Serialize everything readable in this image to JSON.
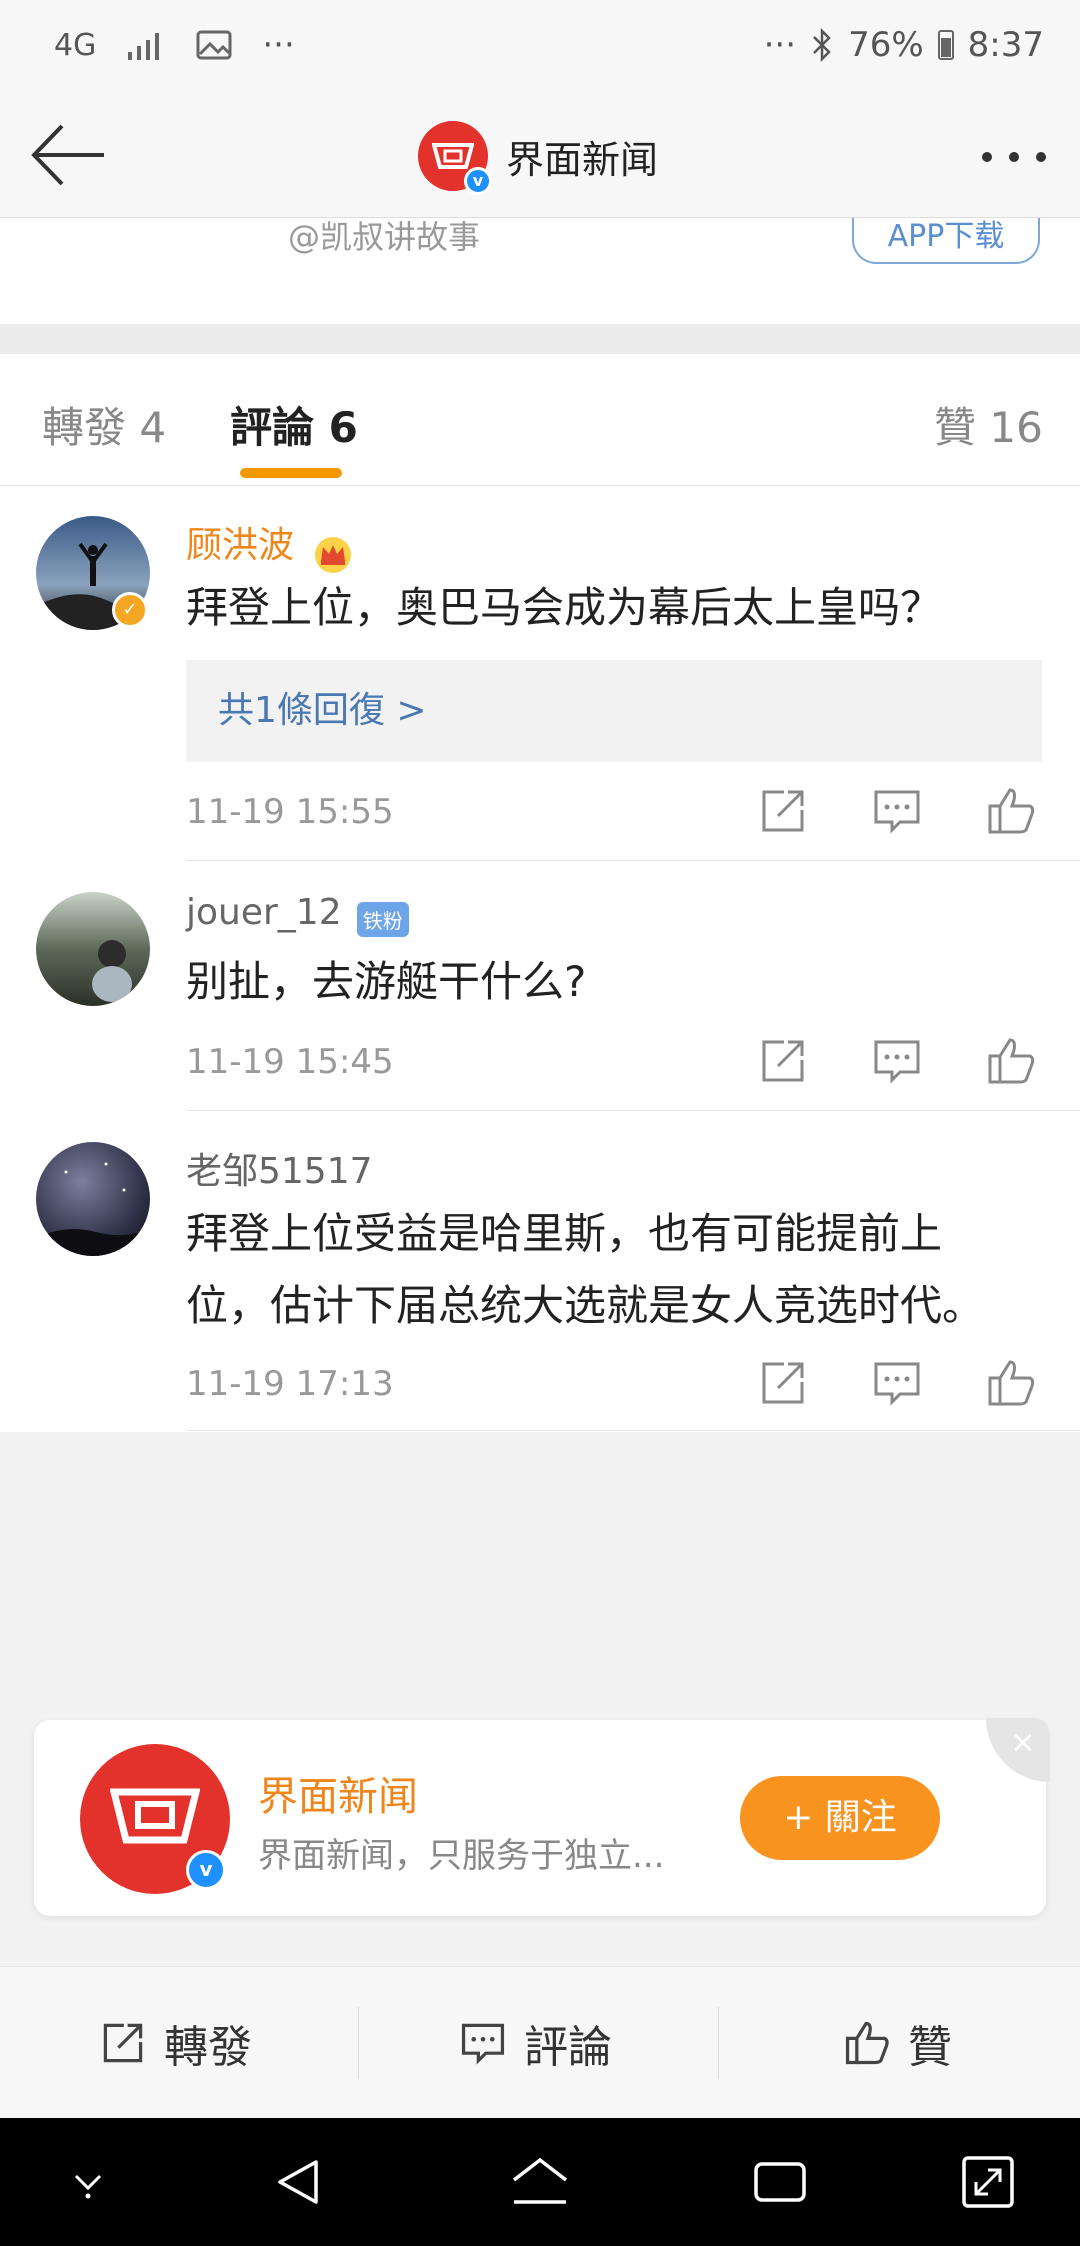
{
  "status_bar": {
    "network": "4G",
    "more": "···",
    "more_right": "···",
    "battery": "76%",
    "time": "8:37"
  },
  "header": {
    "title": "界面新闻",
    "verified": "v"
  },
  "strip": {
    "source_text": "@凯叔讲故事",
    "app_button": "APP下载"
  },
  "tabs": [
    {
      "label": "轉發 4"
    },
    {
      "label": "評論 6"
    },
    {
      "label": "贊 16"
    }
  ],
  "comments": [
    {
      "username": "顾洪波",
      "text": "拜登上位，奥巴马会成为幕后太上皇吗？",
      "reply_link": "共1條回復 >",
      "time": "11-19 15:55"
    },
    {
      "username": "jouer_12",
      "badge": "铁粉",
      "text": "别扯，去游艇干什么?",
      "time": "11-19 15:45"
    },
    {
      "username": "老邹51517",
      "text_line1": "拜登上位受益是哈里斯，也有可能提前上",
      "text_line2": "位，估计下届总统大选就是女人竞选时代。",
      "time": "11-19 17:13"
    }
  ],
  "follow_card": {
    "name": "界面新闻",
    "description": "界面新闻，只服务于独立...",
    "follow_label": "+ 關注",
    "close": "×"
  },
  "bottom_bar": {
    "repost": "轉發",
    "comment": "評論",
    "like": "贊"
  },
  "colors": {
    "accent_orange": "#f39800",
    "brand_red": "#e3312b",
    "link_blue": "#4a78b3"
  }
}
